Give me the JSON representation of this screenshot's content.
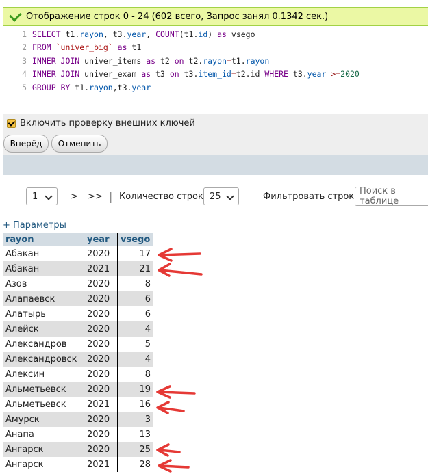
{
  "status": {
    "message": "Отображение строк 0 - 24 (602 всего, Запрос занял 0.1342 сек.)"
  },
  "sql": {
    "lines": [
      {
        "num": "1",
        "parts": [
          [
            "kw",
            "SELECT "
          ],
          [
            "txt",
            "t1."
          ],
          [
            "var",
            "rayon"
          ],
          [
            "txt",
            ", t3."
          ],
          [
            "var",
            "year"
          ],
          [
            "txt",
            ", "
          ],
          [
            "kw",
            "COUNT"
          ],
          [
            "txt",
            "(t1."
          ],
          [
            "var",
            "id"
          ],
          [
            "txt",
            ") "
          ],
          [
            "kw",
            "as "
          ],
          [
            "txt",
            "vsego"
          ]
        ]
      },
      {
        "num": "2",
        "parts": [
          [
            "kw",
            "FROM "
          ],
          [
            "str",
            "`univer_big`"
          ],
          [
            "kw",
            " as "
          ],
          [
            "txt",
            "t1"
          ]
        ]
      },
      {
        "num": "3",
        "parts": [
          [
            "kw",
            "INNER JOIN "
          ],
          [
            "txt",
            "univer_items "
          ],
          [
            "kw",
            "as "
          ],
          [
            "txt",
            "t2 "
          ],
          [
            "kw",
            "on "
          ],
          [
            "txt",
            "t2."
          ],
          [
            "var",
            "rayon"
          ],
          [
            "op",
            "="
          ],
          [
            "txt",
            "t1."
          ],
          [
            "var",
            "rayon"
          ]
        ]
      },
      {
        "num": "4",
        "parts": [
          [
            "kw",
            "INNER JOIN "
          ],
          [
            "txt",
            "univer_exam "
          ],
          [
            "kw",
            "as "
          ],
          [
            "txt",
            "t3 "
          ],
          [
            "kw",
            "on "
          ],
          [
            "txt",
            "t3."
          ],
          [
            "var",
            "item_id"
          ],
          [
            "op",
            "="
          ],
          [
            "txt",
            "t2.id "
          ],
          [
            "kw",
            "WHERE "
          ],
          [
            "txt",
            "t3."
          ],
          [
            "var",
            "year "
          ],
          [
            "op",
            ">="
          ],
          [
            "num",
            "2020"
          ]
        ]
      },
      {
        "num": "5",
        "parts": [
          [
            "kw",
            "GROUP BY "
          ],
          [
            "txt",
            "t1."
          ],
          [
            "var",
            "rayon"
          ],
          [
            "txt",
            ",t3."
          ],
          [
            "var",
            "year"
          ]
        ]
      }
    ]
  },
  "options": {
    "fk_check_label": "Включить проверку внешних ключей"
  },
  "buttons": {
    "go": "Вперёд",
    "cancel": "Отменить"
  },
  "nav": {
    "page_value": "1",
    "next": ">",
    "last": ">>",
    "separator": "|",
    "rows_label": "Количество строк:",
    "rows_value": "25",
    "filter_label": "Фильтровать строки:",
    "filter_placeholder": "Поиск в таблице"
  },
  "params_link": "+ Параметры",
  "table": {
    "headers": [
      "rayon",
      "year",
      "vsego"
    ],
    "rows": [
      [
        "Абакан",
        "2020",
        "17"
      ],
      [
        "Абакан",
        "2021",
        "21"
      ],
      [
        "Азов",
        "2020",
        "8"
      ],
      [
        "Алапаевск",
        "2020",
        "6"
      ],
      [
        "Алатырь",
        "2020",
        "6"
      ],
      [
        "Алейск",
        "2020",
        "4"
      ],
      [
        "Александров",
        "2020",
        "5"
      ],
      [
        "Александровск",
        "2020",
        "4"
      ],
      [
        "Алексин",
        "2020",
        "8"
      ],
      [
        "Альметьевск",
        "2020",
        "19"
      ],
      [
        "Альметьевск",
        "2021",
        "16"
      ],
      [
        "Амурск",
        "2020",
        "3"
      ],
      [
        "Анапа",
        "2020",
        "13"
      ],
      [
        "Ангарск",
        "2020",
        "25"
      ],
      [
        "Ангарск",
        "2021",
        "28"
      ]
    ]
  },
  "colors": {
    "annotation_arrow": "#e53935",
    "header_bg": "#d3dce3",
    "success_bg": "#ebf8a4"
  }
}
